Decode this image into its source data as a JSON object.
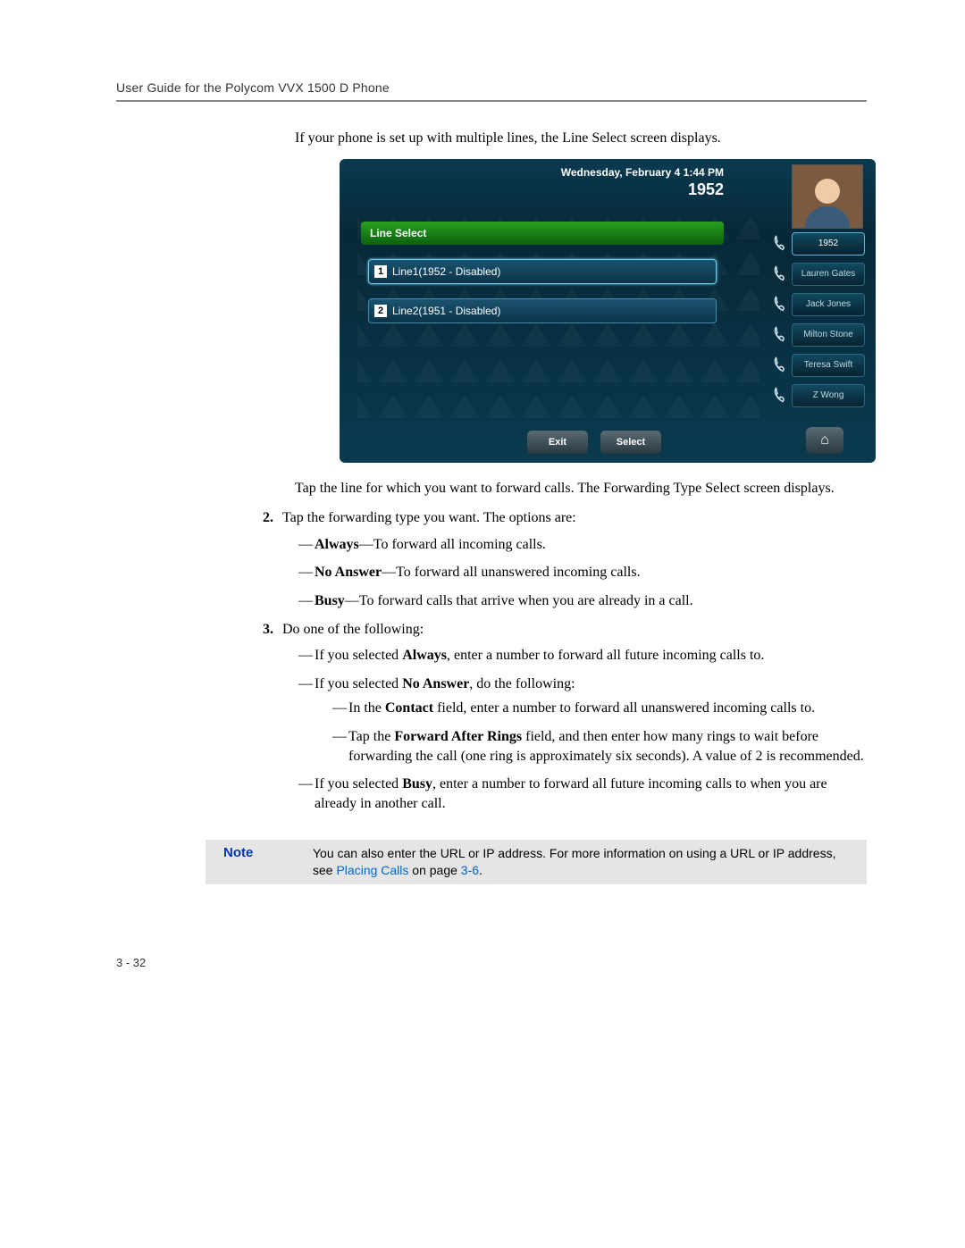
{
  "header": {
    "title": "User Guide for the Polycom VVX 1500 D Phone"
  },
  "intro": "If your phone is set up with multiple lines, the Line Select screen displays.",
  "screenshot": {
    "datetime": "Wednesday, February 4  1:44 PM",
    "extension": "1952",
    "title": "Line Select",
    "line1_num": "1",
    "line1_text": "Line1(1952 - Disabled)",
    "line2_num": "2",
    "line2_text": "Line2(1951 - Disabled)",
    "side": {
      "b1": "1952",
      "b2": "Lauren Gates",
      "b3": "Jack Jones",
      "b4": "Milton Stone",
      "b5": "Teresa Swift",
      "b6": "Z Wong"
    },
    "exit": "Exit",
    "select": "Select",
    "home_glyph": "⌂"
  },
  "afterScreenshot": "Tap the line for which you want to forward calls. The Forwarding Type Select screen displays.",
  "step2": {
    "lead": "Tap the forwarding type you want. The options are:",
    "always_b": "Always",
    "always_t": "—To forward all incoming calls.",
    "noans_b": "No Answer",
    "noans_t": "—To forward all unanswered incoming calls.",
    "busy_b": "Busy",
    "busy_t": "—To forward calls that arrive when you are already in a call."
  },
  "step3": {
    "lead": "Do one of the following:",
    "opt1_a": "If you selected ",
    "opt1_b": "Always",
    "opt1_c": ", enter a number to forward all future incoming calls to.",
    "opt2_a": "If you selected ",
    "opt2_b": "No Answer",
    "opt2_c": ", do the following:",
    "sub1_a": "In the ",
    "sub1_b": "Contact",
    "sub1_c": " field, enter a number to forward all unanswered incoming calls to.",
    "sub2_a": "Tap the ",
    "sub2_b": "Forward After Rings",
    "sub2_c": " field, and then enter how many rings to wait before forwarding the call (one ring is approximately six seconds). A value of 2 is recommended.",
    "opt3_a": "If you selected ",
    "opt3_b": "Busy",
    "opt3_c": ", enter a number to forward all future incoming calls to when you are already in another call."
  },
  "note": {
    "label": "Note",
    "text_a": "You can also enter the URL or IP address. For more information on using a URL or IP address, see ",
    "link": "Placing Calls",
    "text_b": " on page ",
    "pageref": "3-6",
    "text_c": "."
  },
  "pageNumber": "3 - 32"
}
